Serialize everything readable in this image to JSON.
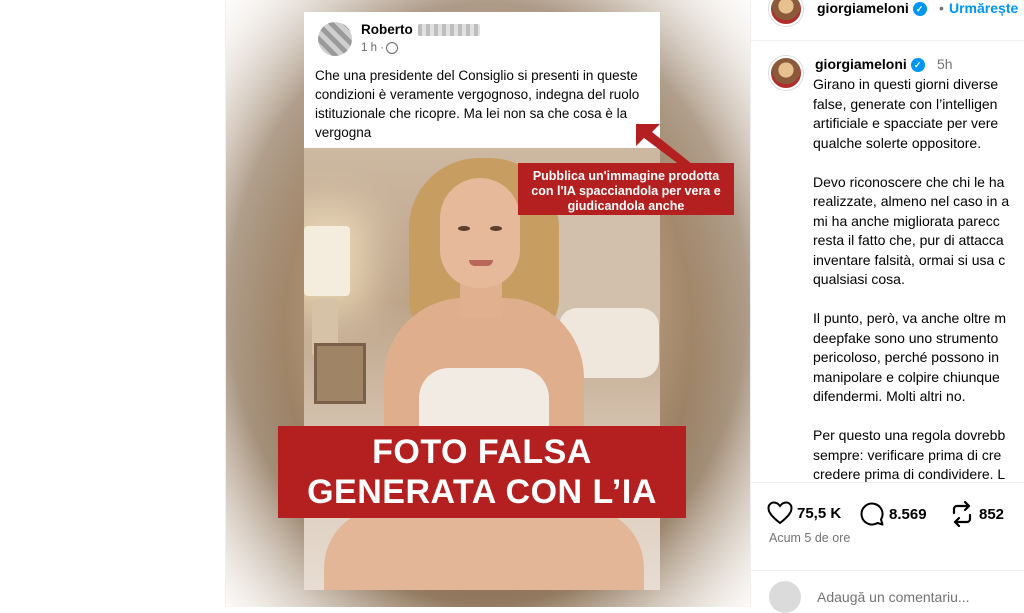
{
  "post_image": {
    "fb_post": {
      "author_first_name": "Roberto",
      "time": "1 h ·",
      "text": "Che una presidente del Consiglio  si presenti in queste condizioni è veramente vergognoso, indegna del ruolo istituzionale che ricopre. Ma lei non sa che cosa è la vergogna"
    },
    "callout": "Pubblica un'immagine prodotta con l'IA spacciandola per vera e giudicandola anche",
    "banner_line1": "FOTO FALSA",
    "banner_line2": "GENERATA CON L’IA"
  },
  "header": {
    "username": "giorgiameloni",
    "separator": "•",
    "follow_label": "Urmărește"
  },
  "caption": {
    "username": "giorgiameloni",
    "time": "5h",
    "text": "Girano in questi giorni diverse\nfalse, generate con l’intelligen\nartificiale e spacciate per vere\nqualche solerte oppositore.\n\nDevo riconoscere che chi le ha\nrealizzate, almeno nel caso in a\nmi ha anche migliorata parecc\nresta il fatto che, pur di attacca\ninventare falsità, ormai si usa c\nqualsiasi cosa.\n\nIl punto, però, va anche oltre m\ndeepfake sono uno strumento\npericoloso, perché possono in\nmanipolare e colpire chiunque\ndifendermi. Molti altri no.\n\nPer questo una regola dovrebb\nsempre: verificare prima di cre\ncredere prima di condividere. L"
  },
  "actions": {
    "likes": "75,5 K",
    "comments": "8.569",
    "reposts": "852"
  },
  "timestamp": "Acum 5 de ore",
  "comment_box": {
    "placeholder": "Adaugă un comentariu..."
  },
  "colors": {
    "accent_blue": "#0095f6",
    "banner_red": "#b42020"
  }
}
